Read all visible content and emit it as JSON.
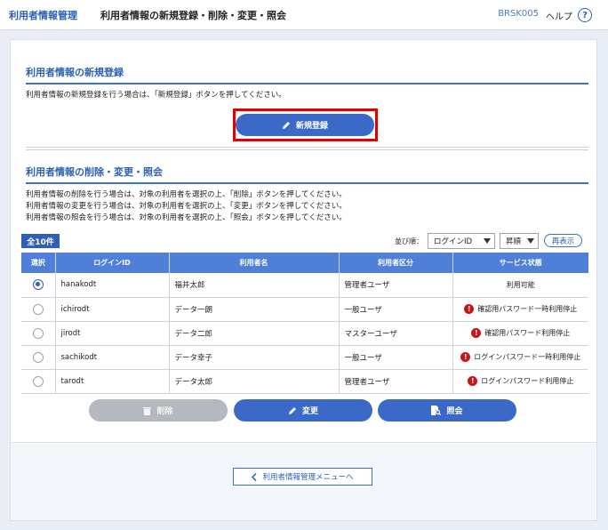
{
  "header": {
    "brand": "利用者情報管理",
    "title": "利用者情報の新規登録・削除・変更・照会",
    "screen_id": "BRSK005",
    "help_label": "ヘルプ",
    "help_icon": "?"
  },
  "register": {
    "title": "利用者情報の新規登録",
    "description": "利用者情報の新規登録を行う場合は、「新規登録」ボタンを押してください。",
    "button_label": "新規登録"
  },
  "manage": {
    "title": "利用者情報の削除・変更・照会",
    "descriptions": [
      "利用者情報の削除を行う場合は、対象の利用者を選択の上、「削除」ボタンを押してください。",
      "利用者情報の変更を行う場合は、対象の利用者を選択の上、「変更」ボタンを押してください。",
      "利用者情報の照会を行う場合は、対象の利用者を選択の上、「照会」ボタンを押してください。"
    ],
    "count_label": "全10件",
    "sort_label": "並び順：",
    "sort_field": "ログインID",
    "sort_order": "昇順",
    "redisplay_label": "再表示",
    "columns": [
      "選択",
      "ログインID",
      "利用者名",
      "利用者区分",
      "サービス状態"
    ],
    "rows": [
      {
        "selected": true,
        "login_id": "hanakodt",
        "name": "福井太郎",
        "type": "管理者ユーザ",
        "status": "利用可能",
        "warn": false
      },
      {
        "selected": false,
        "login_id": "ichirodt",
        "name": "データ一朗",
        "type": "一般ユーザ",
        "status": "確認用パスワード一時利用停止",
        "warn": true
      },
      {
        "selected": false,
        "login_id": "jirodt",
        "name": "データ二郎",
        "type": "マスターユーザ",
        "status": "確認用パスワード利用停止",
        "warn": true
      },
      {
        "selected": false,
        "login_id": "sachikodt",
        "name": "データ幸子",
        "type": "一般ユーザ",
        "status": "ログインパスワード一時利用停止",
        "warn": true
      },
      {
        "selected": false,
        "login_id": "tarodt",
        "name": "データ太郎",
        "type": "管理者ユーザ",
        "status": "ログインパスワード利用停止",
        "warn": true
      }
    ],
    "buttons": {
      "delete": "削除",
      "change": "変更",
      "inquiry": "照会"
    }
  },
  "footer": {
    "menu_button": "利用者情報管理メニューへ"
  },
  "colors": {
    "accent": "#3b69c7",
    "highlight_frame": "#e00000",
    "warning": "#c2181b"
  }
}
